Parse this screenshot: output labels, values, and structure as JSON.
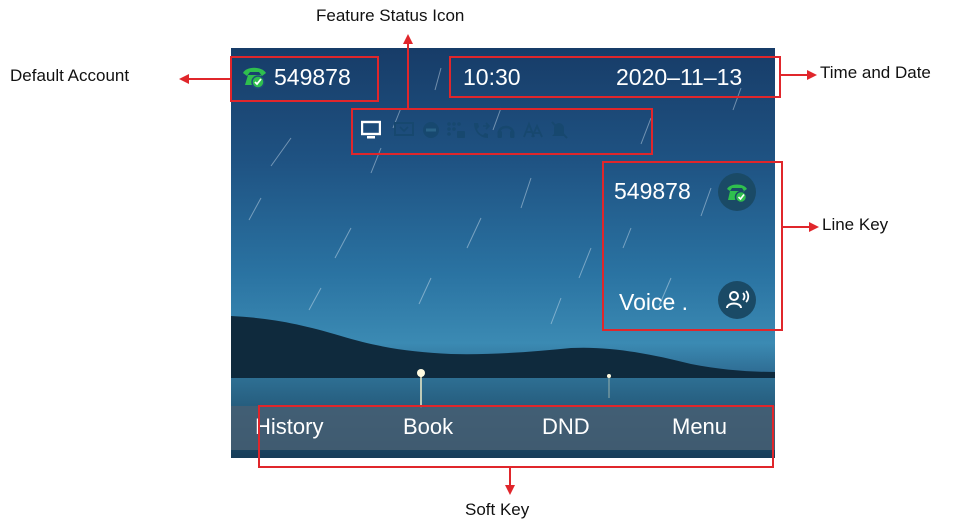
{
  "callouts": {
    "feature_status": "Feature Status Icon",
    "default_account": "Default Account",
    "time_and_date": "Time and Date",
    "line_key": "Line Key",
    "soft_key": "Soft Key"
  },
  "status_bar": {
    "account": "549878",
    "time": "10:30",
    "date": "2020–11–13"
  },
  "feature_icons": [
    "monitor-icon",
    "screen-icon",
    "dnd-icon",
    "keypad-lock-icon",
    "call-forward-icon",
    "headset-icon",
    "font-size-icon",
    "ringer-mute-icon"
  ],
  "line_keys": [
    {
      "label": "549878",
      "icon": "phone-registered-icon"
    },
    {
      "label": "Voice .",
      "icon": "voice-mail-icon"
    }
  ],
  "soft_keys": [
    "History",
    "Book",
    "DND",
    "Menu"
  ],
  "colors": {
    "accent_green": "#2fbf4e",
    "callout_red": "#e0262b"
  }
}
